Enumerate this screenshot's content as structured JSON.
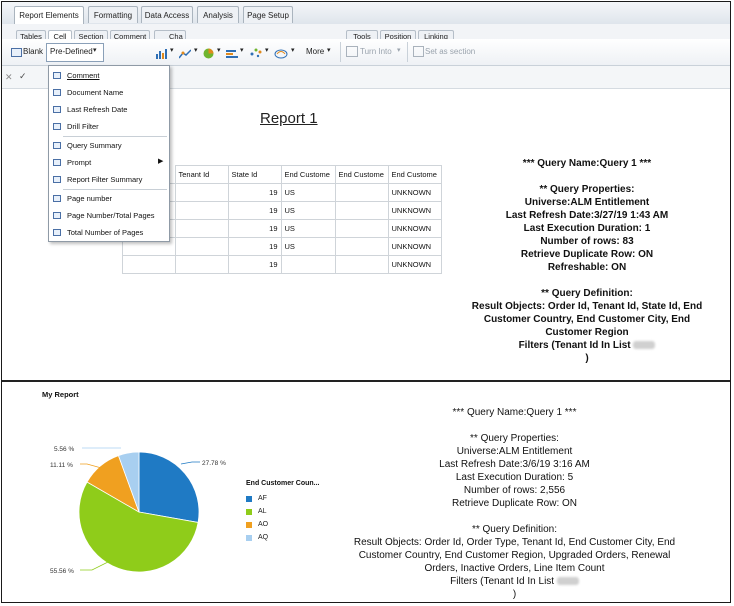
{
  "tabs": [
    "Report Elements",
    "Formatting",
    "Data Access",
    "Analysis",
    "Page Setup"
  ],
  "subtabs_left": [
    "Tables",
    "Cell",
    "Section",
    "Comment",
    "Cha"
  ],
  "subtabs_right": [
    "Tools",
    "Position",
    "Linking"
  ],
  "toolbar": {
    "blank_label": "Blank",
    "predefined_label": "Pre-Defined",
    "more_label": "More",
    "turn_into_label": "Turn Into",
    "set_as_section_label": "Set as section"
  },
  "menu": {
    "group1": [
      "Comment",
      "Document Name",
      "Last Refresh Date",
      "Drill Filter"
    ],
    "group2": [
      "Query Summary",
      "Prompt",
      "Report Filter Summary"
    ],
    "group3": [
      "Page number",
      "Page Number/Total Pages",
      "Total Number of Pages"
    ]
  },
  "report1": {
    "title": "Report 1",
    "columns": [
      "Tenant Id",
      "State Id",
      "End Custome",
      "End Custome",
      "End Custome"
    ],
    "rows": [
      [
        "",
        "19",
        "US",
        "",
        "UNKNOWN"
      ],
      [
        "",
        "19",
        "US",
        "",
        "UNKNOWN"
      ],
      [
        "",
        "19",
        "US",
        "",
        "UNKNOWN"
      ],
      [
        "",
        "19",
        "US",
        "",
        "UNKNOWN"
      ],
      [
        "",
        "19",
        "",
        "",
        "UNKNOWN"
      ]
    ]
  },
  "summary1": {
    "query_name": "*** Query Name:Query 1 ***",
    "props_header": "** Query Properties:",
    "universe": "Universe:ALM Entitlement",
    "refresh": "Last Refresh Date:3/27/19 1:43 AM",
    "duration": "Last Execution Duration: 1",
    "rows": "Number of rows: 83",
    "duplicate": "Retrieve Duplicate Row: ON",
    "refreshable": "Refreshable: ON",
    "def_header": "** Query Definition:",
    "result_l1": "Result Objects: Order Id, Tenant Id, State Id, End",
    "result_l2": "Customer Country, End Customer City, End",
    "result_l3": "Customer Region",
    "filters": "Filters (Tenant Id In List",
    "close": ")"
  },
  "report2": {
    "title": "My Report",
    "legend_title": "End Customer Coun...",
    "pie_labels": [
      "5.56 %",
      "11.11 %",
      "27.78 %",
      "55.56 %"
    ]
  },
  "chart_data": {
    "type": "pie",
    "title": "My Report",
    "legend_title": "End Customer Coun...",
    "categories": [
      "AF",
      "AL",
      "AO",
      "AQ"
    ],
    "values": [
      27.78,
      55.56,
      11.11,
      5.56
    ],
    "colors": [
      "#1f7ac4",
      "#8fcc1a",
      "#f0a020",
      "#a8cff0"
    ],
    "legend_placement": "right"
  },
  "summary2": {
    "query_name": "*** Query Name:Query 1 ***",
    "props_header": "** Query Properties:",
    "universe": "Universe:ALM Entitlement",
    "refresh": "Last Refresh Date:3/6/19 3:16 AM",
    "duration": "Last Execution Duration: 5",
    "rows": "Number of rows: 2,556",
    "duplicate": "Retrieve Duplicate Row: ON",
    "def_header": "** Query Definition:",
    "result_l1": "Result Objects: Order Id, Order Type, Tenant Id, End Customer City, End",
    "result_l2": "Customer Country, End Customer Region, Upgraded Orders, Renewal",
    "result_l3": "Orders, Inactive Orders, Line Item Count",
    "filters": "Filters (Tenant Id In List",
    "close": ")"
  }
}
